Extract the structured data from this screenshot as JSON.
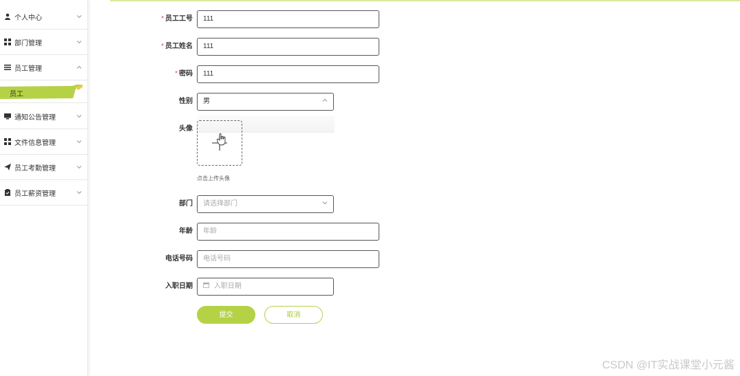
{
  "sidebar": {
    "items": [
      {
        "label": "个人中心",
        "icon": "user-icon"
      },
      {
        "label": "部门管理",
        "icon": "grid-icon"
      },
      {
        "label": "员工管理",
        "icon": "list-icon",
        "expanded": true
      },
      {
        "label": "通知公告管理",
        "icon": "monitor-icon"
      },
      {
        "label": "文件信息管理",
        "icon": "grid-icon"
      },
      {
        "label": "员工考勤管理",
        "icon": "send-icon"
      },
      {
        "label": "员工薪资管理",
        "icon": "clipboard-icon"
      }
    ],
    "submenu": {
      "label": "员工"
    }
  },
  "form": {
    "emp_no": {
      "label": "员工工号",
      "value": "111",
      "required": true
    },
    "emp_name": {
      "label": "员工姓名",
      "value": "111",
      "required": true
    },
    "password": {
      "label": "密码",
      "value": "111",
      "required": true
    },
    "gender": {
      "label": "性别",
      "value": "男"
    },
    "avatar": {
      "label": "头像",
      "tip": "点击上传头像"
    },
    "department": {
      "label": "部门",
      "placeholder": "请选择部门"
    },
    "age": {
      "label": "年龄",
      "placeholder": "年龄"
    },
    "phone": {
      "label": "电话号码",
      "placeholder": "电话号码"
    },
    "hire_date": {
      "label": "入职日期",
      "placeholder": "入职日期"
    },
    "submit_label": "提交",
    "cancel_label": "取消"
  },
  "watermark": "CSDN @IT实战课堂小元酱",
  "colors": {
    "accent": "#b5d246",
    "required": "#e24a4a"
  }
}
